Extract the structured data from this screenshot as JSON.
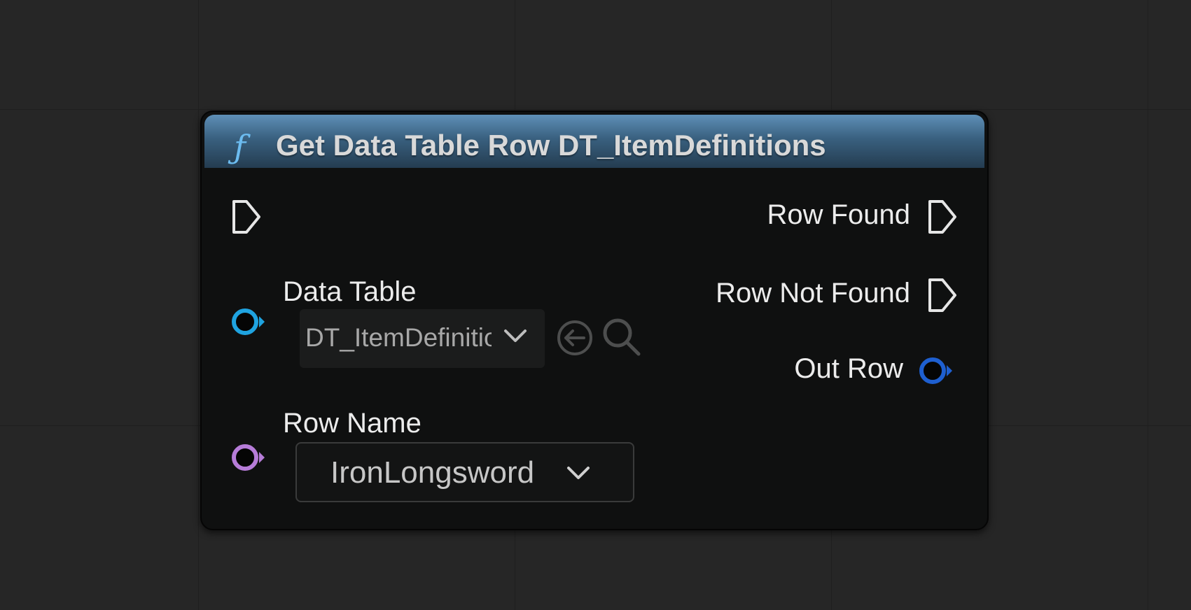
{
  "node": {
    "title": "Get Data Table Row DT_ItemDefinitions",
    "icon": "function-icon",
    "header_color": "#3d6a8e"
  },
  "pins": {
    "exec_in": {
      "icon": "exec-pin-icon"
    },
    "row_found": {
      "label": "Row Found",
      "icon": "exec-pin-icon"
    },
    "row_not_found": {
      "label": "Row Not Found",
      "icon": "exec-pin-icon"
    },
    "data_table": {
      "label": "Data Table",
      "color": "#1fa3e0",
      "value": "DT_ItemDefinitions"
    },
    "row_name": {
      "label": "Row Name",
      "color": "#b67cd8",
      "value": "IronLongsword"
    },
    "out_row": {
      "label": "Out Row",
      "color": "#1e5fd0"
    }
  },
  "colors": {
    "exec_pin": "#e6e6e6",
    "background": "#262626",
    "node_body": "#0f1010"
  }
}
